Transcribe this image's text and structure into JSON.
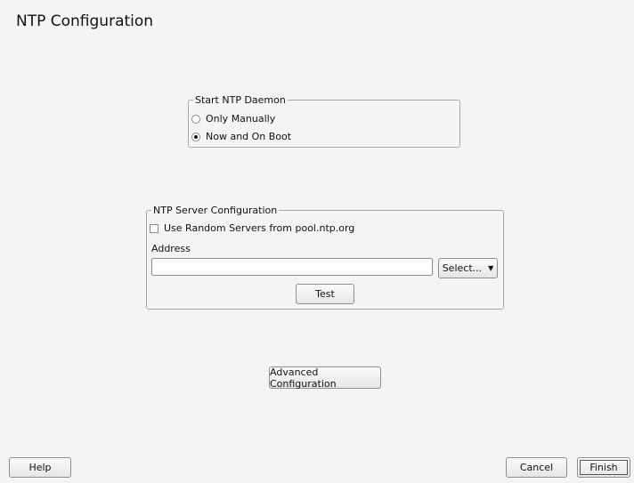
{
  "page": {
    "title": "NTP Configuration"
  },
  "daemon": {
    "legend": "Start NTP Daemon",
    "options": [
      {
        "label": "Only Manually",
        "checked": false
      },
      {
        "label": "Now and On Boot",
        "checked": true
      }
    ]
  },
  "server": {
    "legend": "NTP Server Configuration",
    "random_label": "Use Random Servers from pool.ntp.org",
    "random_checked": false,
    "address_label": "Address",
    "address_value": "",
    "select_label": "Select...",
    "test_label": "Test"
  },
  "advanced_label": "Advanced Configuration",
  "footer": {
    "help_label": "Help",
    "cancel_label": "Cancel",
    "finish_label": "Finish"
  }
}
